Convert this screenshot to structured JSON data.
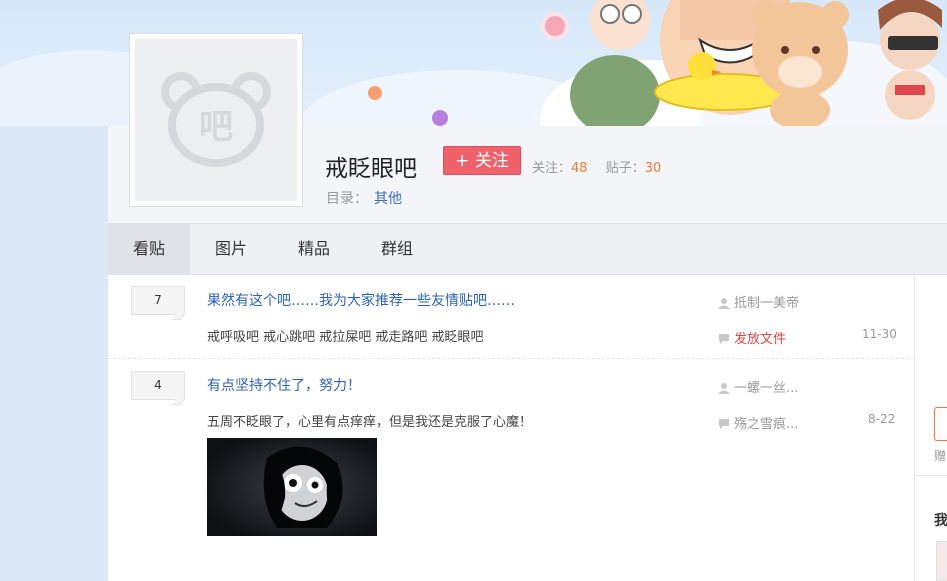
{
  "forum": {
    "name": "戒眨眼吧",
    "follow_label": "+ 关注",
    "follow_count_label": "关注：",
    "follow_count": "48",
    "post_count_label": "贴子：",
    "post_count": "30",
    "catalog_label": "目录：",
    "catalog_value": "其他",
    "avatar_glyph": "吧"
  },
  "tabs": [
    {
      "label": "看贴",
      "active": true
    },
    {
      "label": "图片"
    },
    {
      "label": "精品"
    },
    {
      "label": "群组"
    }
  ],
  "threads": [
    {
      "reply_count": "7",
      "title": "果然有这个吧……我为大家推荐一些友情贴吧……",
      "abstract": "戒呼吸吧 戒心跳吧 戒拉屎吧 戒走路吧 戒眨眼吧",
      "author": "抵制一美帝",
      "last_reply": "发放文件",
      "date": "11-30"
    },
    {
      "reply_count": "4",
      "title": "有点坚持不住了，努力！",
      "abstract": "五周不眨眼了，心里有点痒痒，但是我还是克服了心魔！",
      "author": "一螺一丝...",
      "last_reply": "殇之雪痕...",
      "date": "8-22"
    }
  ],
  "right_col": {
    "partial_text_1": "赠",
    "partial_text_2": "我"
  },
  "colors": {
    "accent_link": "#2d64b3",
    "follow_button": "#f0626b",
    "count_orange": "#ee7a33"
  }
}
